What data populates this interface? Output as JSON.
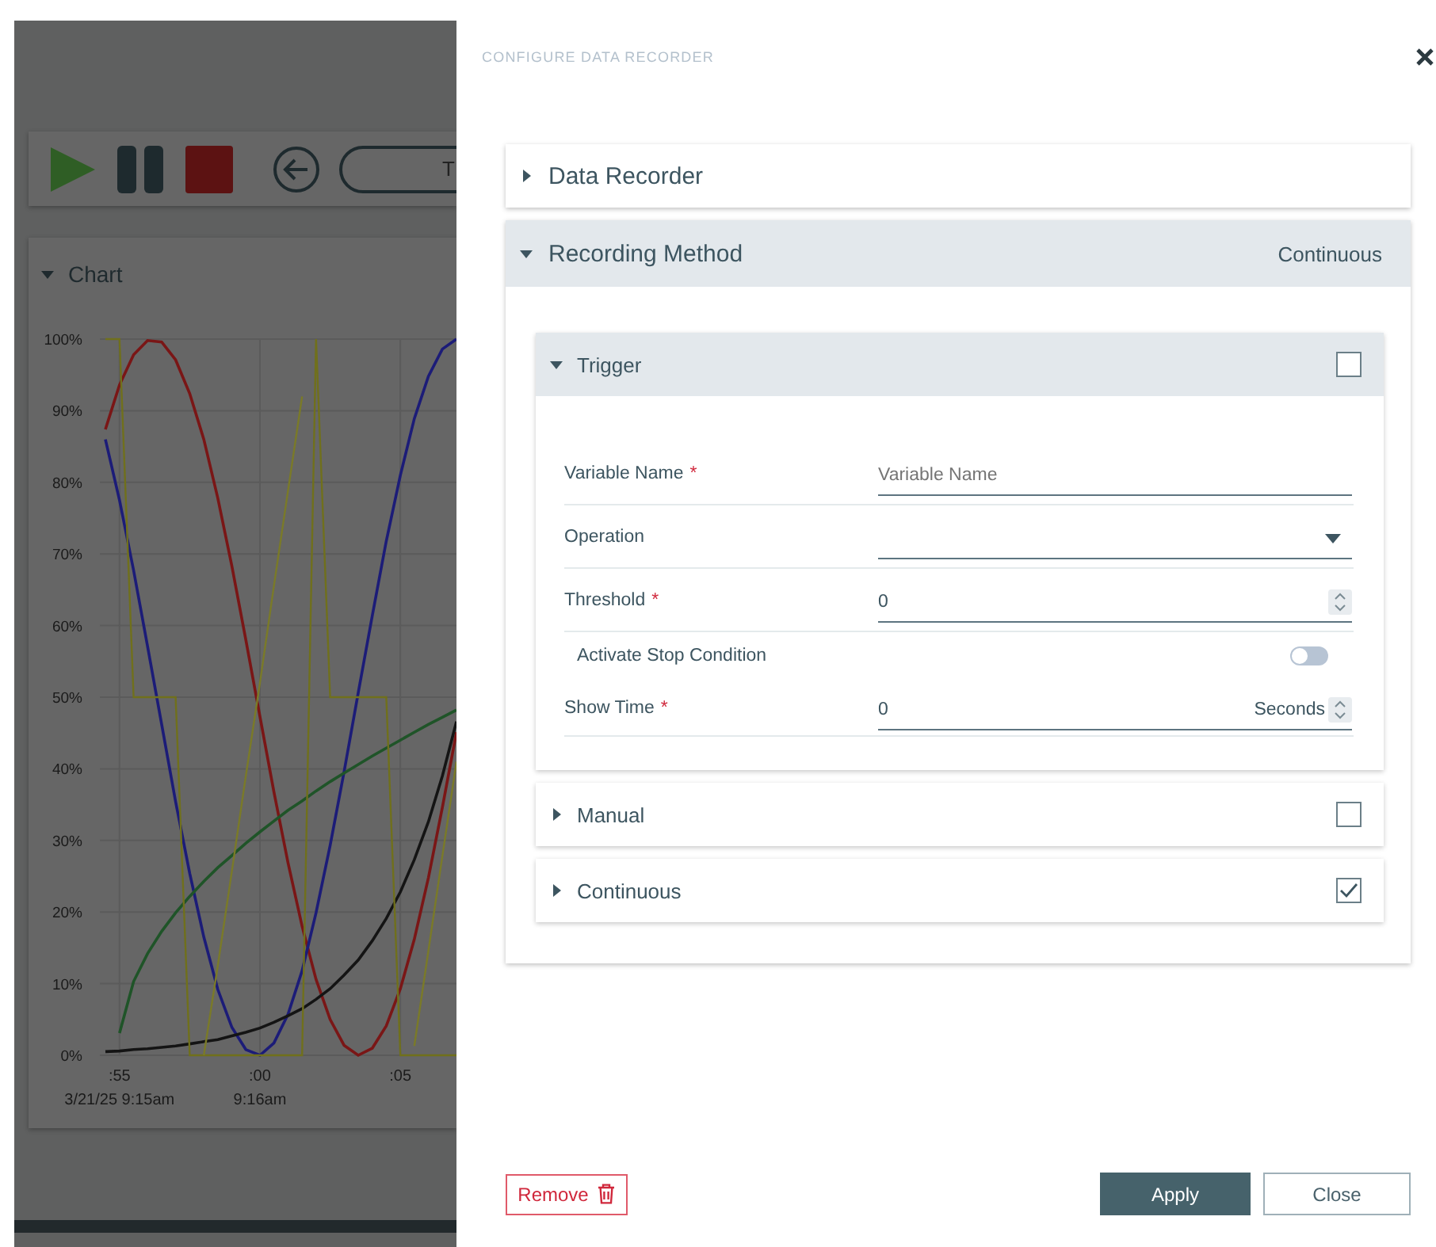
{
  "app": {
    "toolbar": {
      "field_value": "T"
    },
    "chart": {
      "title": "Chart",
      "expanded": true,
      "chart_data": {
        "type": "line",
        "grid": true,
        "ylim": [
          0,
          100
        ],
        "categories": [
          null,
          ":55",
          null,
          null,
          null,
          null,
          null,
          null,
          null,
          null,
          null,
          ":00",
          null,
          null,
          null,
          null,
          null,
          null,
          null,
          null,
          null,
          ":05",
          null,
          null,
          null,
          null
        ],
        "yticks": [
          {
            "value": 0,
            "label": "0%"
          },
          {
            "value": 10,
            "label": "10%"
          },
          {
            "value": 20,
            "label": "20%"
          },
          {
            "value": 30,
            "label": "30%"
          },
          {
            "value": 40,
            "label": "40%"
          },
          {
            "value": 50,
            "label": "50%"
          },
          {
            "value": 60,
            "label": "60%"
          },
          {
            "value": 70,
            "label": "70%"
          },
          {
            "value": 80,
            "label": "80%"
          },
          {
            "value": 90,
            "label": "90%"
          },
          {
            "value": 100,
            "label": "100%"
          }
        ],
        "series": [
          {
            "color": "#7a1616",
            "values": [
              87.4,
              93.6,
              97.8,
              99.8,
              99.6,
              97.1,
              92.4,
              86.0,
              77.8,
              68.3,
              58.0,
              47.3,
              36.8,
              26.9,
              18.0,
              10.6,
              5.0,
              1.4,
              0,
              1.0,
              4.1,
              9.3,
              16.2,
              24.8,
              34.6,
              45.1
            ]
          },
          {
            "color": "#1c1c78",
            "values": [
              86.0,
              77.5,
              67.7,
              57.1,
              46.2,
              35.4,
              25.4,
              16.5,
              9.2,
              3.9,
              0.8,
              0,
              1.7,
              5.7,
              11.8,
              19.9,
              29.3,
              39.6,
              50.6,
              61.4,
              71.8,
              81.0,
              88.9,
              94.8,
              98.6,
              100
            ]
          },
          {
            "color": "#1f5428",
            "values": [
              null,
              3.1,
              10.3,
              14.2,
              17.3,
              19.9,
              22.2,
              24.3,
              26.2,
              27.9,
              29.6,
              31.2,
              32.7,
              34.2,
              35.5,
              36.9,
              38.2,
              39.4,
              40.6,
              41.8,
              42.9,
              44.0,
              45.1,
              46.2,
              47.2,
              48.2
            ]
          },
          {
            "color": "#141414",
            "values": [
              0.5,
              0.6,
              0.8,
              0.9,
              1.1,
              1.3,
              1.6,
              1.9,
              2.2,
              2.7,
              3.2,
              3.8,
              4.6,
              5.5,
              6.5,
              7.8,
              9.3,
              11.2,
              13.3,
              16.0,
              19.1,
              22.8,
              27.3,
              32.6,
              39.0,
              46.6
            ]
          },
          {
            "color": "#70701c",
            "values": [
              100,
              100,
              50,
              50,
              50,
              50,
              0,
              0,
              0,
              0,
              0,
              0,
              0,
              0,
              0,
              100,
              50,
              50,
              50,
              50,
              50,
              0,
              0,
              0,
              0,
              0
            ]
          },
          {
            "color": "#7a7a28",
            "values": [
              null,
              null,
              null,
              null,
              null,
              null,
              null,
              0,
              12.5,
              25.7,
              39,
              52,
              65.5,
              78.8,
              92,
              null,
              null,
              null,
              null,
              null,
              null,
              null,
              1.3,
              14.6,
              27.8,
              41
            ]
          }
        ],
        "annotations": [
          "3/21/25 9:15am",
          "9:16am"
        ]
      }
    }
  },
  "drawer": {
    "title": "CONFIGURE DATA RECORDER",
    "sections": [
      {
        "title": "Data Recorder",
        "expanded": false
      },
      {
        "title": "Recording Method",
        "expanded": true,
        "value": "Continuous",
        "methods": [
          {
            "title": "Trigger",
            "expanded": true,
            "checked": false,
            "fields": [
              {
                "kind": "text",
                "label": "Variable Name",
                "mark": "*",
                "placeholder": "Variable Name"
              },
              {
                "kind": "select",
                "label": "Operation"
              },
              {
                "kind": "number",
                "label": "Threshold",
                "mark": "*",
                "value": "0"
              },
              {
                "kind": "toggle",
                "label": "Activate Stop Condition",
                "on": false
              },
              {
                "kind": "number",
                "label": "Show Time",
                "mark": "*",
                "value": "0",
                "unit": "Seconds"
              }
            ]
          },
          {
            "title": "Manual",
            "expanded": false,
            "checked": false
          },
          {
            "title": "Continuous",
            "expanded": false,
            "checked": true
          }
        ]
      }
    ],
    "buttons": {
      "remove": "Remove",
      "apply": "Apply",
      "close": "Close"
    }
  }
}
